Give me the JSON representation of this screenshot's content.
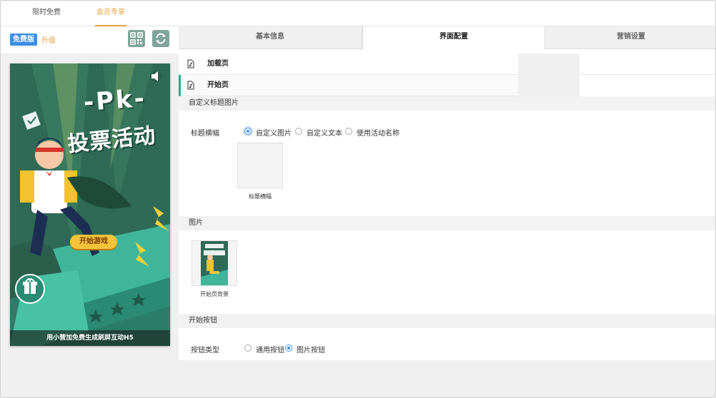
{
  "top_tabs": {
    "free": "限时免费",
    "member": "会员专享"
  },
  "left": {
    "badge": "免费版",
    "upgrade": "升级",
    "qr_icon": "qrcode-icon",
    "refresh_icon": "refresh-icon"
  },
  "preview": {
    "pk": "-Pk-",
    "title": "投票活动",
    "start_button": "开始游戏",
    "caption": "用小营加免费生成刷屏互动H5"
  },
  "right_tabs": {
    "basic": "基本信息",
    "ui": "界面配置",
    "marketing": "营销设置"
  },
  "pages": {
    "loading": "加载页",
    "start": "开始页"
  },
  "section_title_image": {
    "header": "自定义标题图片",
    "label": "标题横幅",
    "options": [
      "自定义图片",
      "自定义文本",
      "使用活动名称"
    ],
    "thumb_caption": "标题横幅"
  },
  "section_image": {
    "header": "图片",
    "thumb_caption": "开始页背景"
  },
  "section_button": {
    "header": "开始按钮",
    "label": "按钮类型",
    "options": [
      "通用按钮",
      "图片按钮"
    ]
  },
  "colors": {
    "accent": "#e6a23c",
    "badge": "#3a8ee6",
    "active": "#20b28a"
  }
}
